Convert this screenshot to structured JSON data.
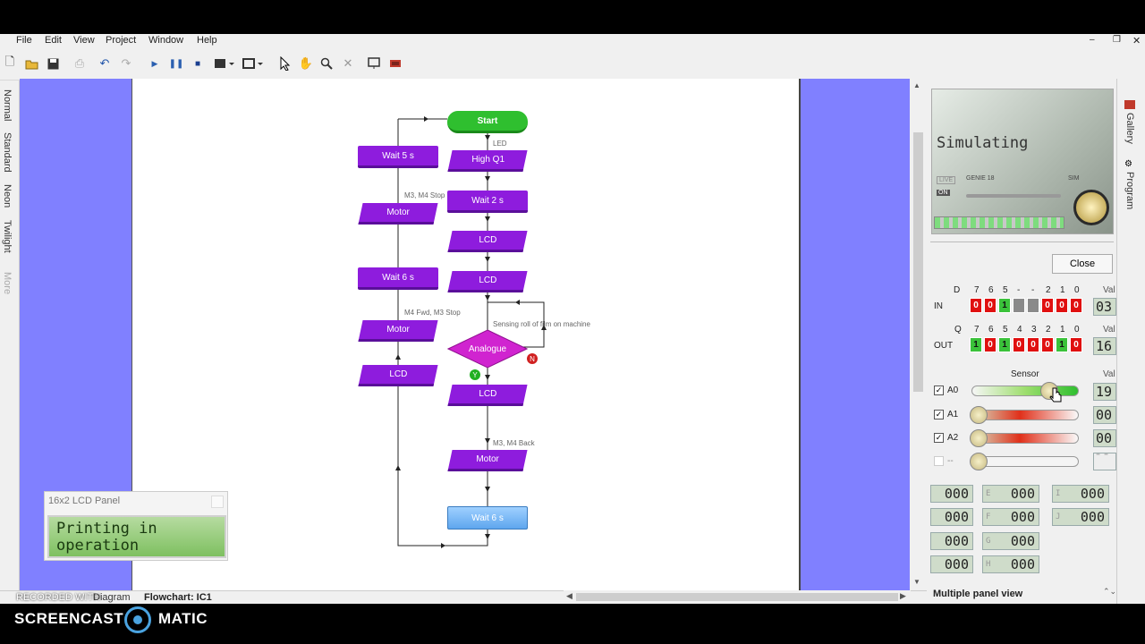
{
  "menu": [
    "File",
    "Edit",
    "View",
    "Project",
    "Window",
    "Help"
  ],
  "side_tabs": [
    "Normal",
    "Standard",
    "Neon",
    "Twilight",
    "More"
  ],
  "flowchart": {
    "start": "Start",
    "led": "LED",
    "high_q1": "High Q1",
    "wait2": "Wait 2 s",
    "lcd1": "LCD",
    "lcd2": "LCD",
    "sensing": "Sensing roll of film on machine",
    "analogue": "Analogue",
    "yes": "Y",
    "no": "N",
    "lcd3": "LCD",
    "m3m4back": "M3, M4 Back",
    "motor_back": "Motor",
    "wait6_bottom": "Wait 6 s",
    "wait5": "Wait 5 s",
    "m3m4stop": "M3, M4 Stop",
    "motor_stop": "Motor",
    "wait6": "Wait 6 s",
    "m4fwd": "M4 Fwd, M3 Stop",
    "motor_fwd": "Motor",
    "lcd_left": "LCD"
  },
  "lcd_panel": {
    "title": "16x2 LCD Panel",
    "line1": "Printing in",
    "line2": "operation"
  },
  "bottom_tabs": {
    "recorded": "RECORDED WITH",
    "diagram": "Diagram",
    "flowchart": "Flowchart: IC1"
  },
  "right_panel": {
    "simulating": "Simulating",
    "genie": "GENIE 18",
    "live": "LIVE",
    "on": "ON",
    "sim": "SIM",
    "close": "Close",
    "d_label": "D",
    "in_label": "IN",
    "q_label": "Q",
    "out_label": "OUT",
    "val": "Val",
    "in_val": "03",
    "out_val": "16",
    "sensor": "Sensor",
    "a0": "A0",
    "a1": "A1",
    "a2": "A2",
    "a3": "--",
    "a0_val": "19",
    "a1_val": "00",
    "a2_val": "00",
    "a3_val": "---",
    "a0_level": 0.76,
    "a1_level": 0.0,
    "a2_level": 0.0,
    "a3_level": 0.0,
    "in_bits": [
      "0",
      "0",
      "1",
      "",
      "",
      "0",
      "0",
      "0"
    ],
    "out_bits": [
      "1",
      "0",
      "1",
      "0",
      "0",
      "0",
      "1",
      "0"
    ],
    "in_headers": [
      "7",
      "6",
      "5",
      "-",
      "-",
      "2",
      "1",
      "0"
    ],
    "out_headers": [
      "7",
      "6",
      "5",
      "4",
      "3",
      "2",
      "1",
      "0"
    ],
    "vars": [
      {
        "name": "",
        "val": "000"
      },
      {
        "name": "E",
        "val": "000"
      },
      {
        "name": "I",
        "val": "000"
      },
      {
        "name": "",
        "val": "000"
      },
      {
        "name": "F",
        "val": "000"
      },
      {
        "name": "J",
        "val": "000"
      },
      {
        "name": "",
        "val": "000"
      },
      {
        "name": "G",
        "val": "000"
      },
      {
        "name": "",
        "val": "000"
      },
      {
        "name": "H",
        "val": "000"
      }
    ],
    "multi_panel": "Multiple panel view"
  },
  "right_tabs": [
    "Gallery",
    "Program"
  ],
  "watermark": {
    "left": "SCREENCAST",
    "right": "MATIC"
  }
}
